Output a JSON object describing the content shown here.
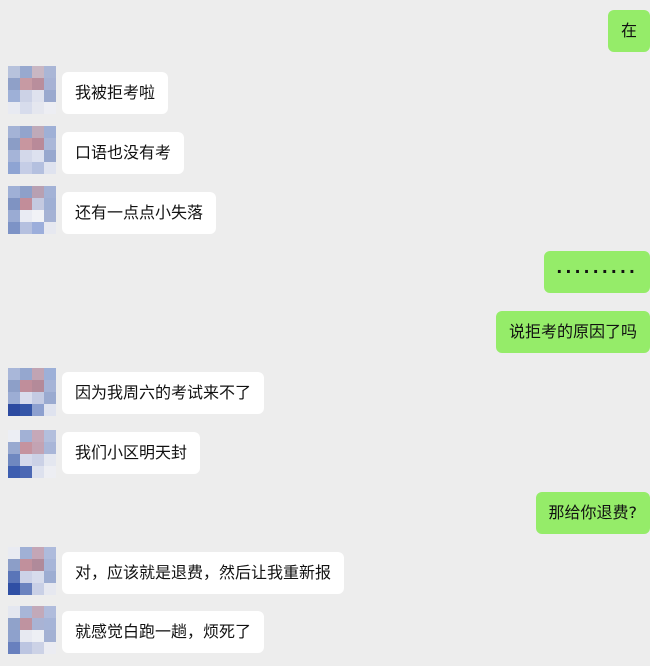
{
  "messages": [
    {
      "side": "out",
      "text": "在"
    },
    {
      "side": "in",
      "text": "我被拒考啦"
    },
    {
      "side": "in",
      "text": "口语也没有考"
    },
    {
      "side": "in",
      "text": "还有一点点小失落"
    },
    {
      "side": "out",
      "text": "·········"
    },
    {
      "side": "out",
      "text": "说拒考的原因了吗"
    },
    {
      "side": "in",
      "text": "因为我周六的考试来不了"
    },
    {
      "side": "in",
      "text": "我们小区明天封"
    },
    {
      "side": "out",
      "text": "那给你退费?"
    },
    {
      "side": "in",
      "text": "对，应该就是退费，然后让我重新报"
    },
    {
      "side": "in",
      "text": "就感觉白跑一趟，烦死了"
    }
  ],
  "colors": {
    "background": "#ededed",
    "incoming_bubble": "#ffffff",
    "outgoing_bubble": "#95ec69"
  }
}
